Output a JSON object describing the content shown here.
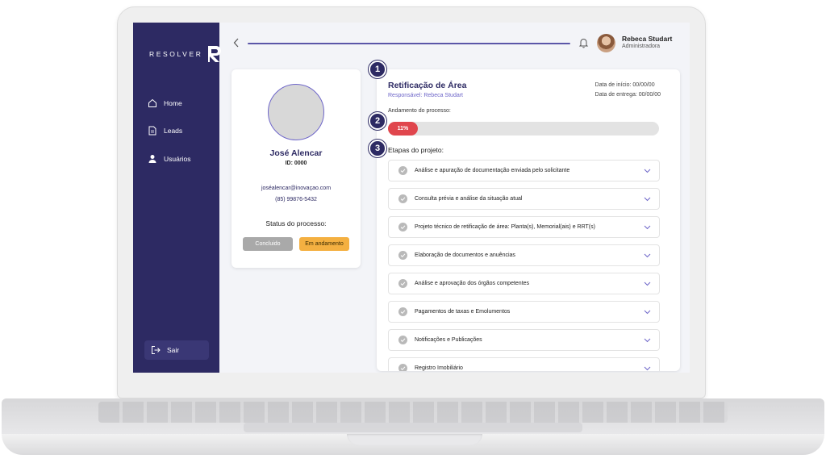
{
  "brand": {
    "logo_text": "RESOLVER"
  },
  "sidebar": {
    "items": [
      {
        "label": "Home",
        "icon": "home-icon"
      },
      {
        "label": "Leads",
        "icon": "document-icon"
      },
      {
        "label": "Usuários",
        "icon": "user-icon"
      }
    ],
    "logout_label": "Sair"
  },
  "topbar": {
    "user_name": "Rebeca Studart",
    "user_role": "Administradora"
  },
  "profile": {
    "name": "José Alencar",
    "id": "ID: 0000",
    "email": "joséalencar@inovaçao.com",
    "phone": "(85) 99876-5432",
    "status_label": "Status do processo:",
    "status_done": "Concluido",
    "status_progress": "Em andamento"
  },
  "process": {
    "title": "Retificação de Área",
    "responsible": "Responsável: Rebeca Studart",
    "start_date": "Data de início: 00/00/00",
    "delivery_date": "Data de entrega: 00/00/00",
    "progress_label": "Andamento do processo:",
    "progress_percent": 11,
    "progress_text": "11%",
    "steps_label": "Etapas do projeto:",
    "steps": [
      "Análise e apuração de documentação enviada pelo solicitante",
      "Consulta prévia e análise da situação atual",
      "Projeto técnico de retificação de área: Planta(s), Memorial(ais) e RRT(s)",
      "Elaboração de documentos e anuências",
      "Análise e aprovação dos órgãos competentes",
      "Pagamentos de taxas e Emolumentos",
      "Notificações e Publicações",
      "Registro Imobiliário"
    ]
  },
  "markers": [
    "1",
    "2",
    "3"
  ],
  "colors": {
    "sidebar": "#2d2a63",
    "accent": "#6e66c9",
    "progress_fill": "#e0464d",
    "in_progress_badge": "#f4b041",
    "done_badge": "#a9a9a9"
  }
}
